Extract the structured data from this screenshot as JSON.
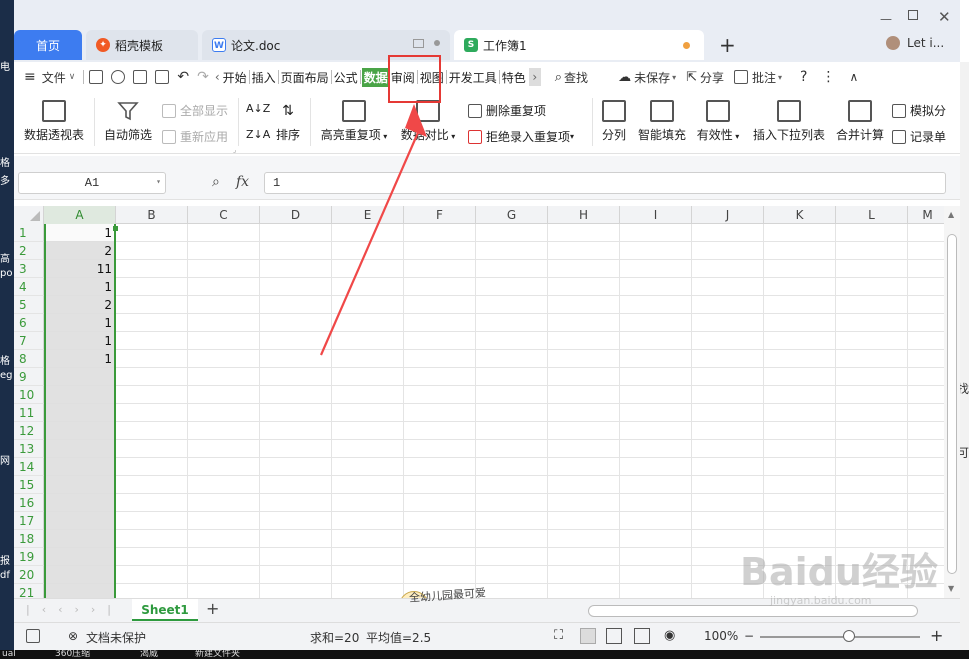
{
  "tabs": {
    "home": "首页",
    "template": "稻壳模板",
    "doc": "论文.doc",
    "workbook": "工作簿1",
    "add": "+",
    "user": "Let i..."
  },
  "menu": {
    "file": "文件",
    "items": [
      "开始",
      "插入",
      "页面布局",
      "公式",
      "数据",
      "审阅",
      "视图",
      "开发工具",
      "特色"
    ],
    "search": "查找",
    "unsaved": "未保存",
    "share": "分享",
    "comment": "批注"
  },
  "tools": {
    "pivot": "数据透视表",
    "autofilter": "自动筛选",
    "showall": "全部显示",
    "reapply": "重新应用",
    "sort": "排序",
    "highlight_dup": "高亮重复项",
    "data_compare": "数据对比",
    "delete_dup": "删除重复项",
    "reject_dup": "拒绝录入重复项",
    "split": "分列",
    "smart_fill": "智能填充",
    "validity": "有效性",
    "dropdown": "插入下拉列表",
    "merge_calc": "合并计算",
    "simulate": "模拟分",
    "record": "记录单"
  },
  "formula": {
    "namebox": "A1",
    "fx": "fx",
    "value": "1"
  },
  "columns": [
    "A",
    "B",
    "C",
    "D",
    "E",
    "F",
    "G",
    "H",
    "I",
    "J",
    "K",
    "L",
    "M"
  ],
  "rows": [
    "1",
    "2",
    "3",
    "4",
    "5",
    "6",
    "7",
    "8",
    "9",
    "10",
    "11",
    "12",
    "13",
    "14",
    "15",
    "16",
    "17",
    "18",
    "19",
    "20",
    "21"
  ],
  "cells_a": [
    "1",
    "2",
    "11",
    "1",
    "2",
    "1",
    "1",
    "1"
  ],
  "sheet": {
    "name": "Sheet1",
    "add": "+"
  },
  "status": {
    "protect": "文档未保护",
    "sum": "求和=20",
    "avg": "平均值=2.5",
    "zoom": "100%"
  },
  "sticker": "全幼儿园最可爱",
  "watermark": {
    "brand": "Baidu经验",
    "url": "jingyan.baidu.com"
  },
  "desktop": {
    "taskbar": [
      "ual",
      "360压缩",
      "渴威",
      "新建文件夹"
    ],
    "left_labels": [
      "电",
      "格",
      "多",
      "高",
      "po",
      "格",
      "eg",
      "网",
      "报",
      "df"
    ],
    "right_labels": [
      "找",
      "可"
    ]
  },
  "colors": {
    "accent_green": "#4aa447",
    "home_tab": "#3d7cf0",
    "highlight_red": "#e53935"
  }
}
